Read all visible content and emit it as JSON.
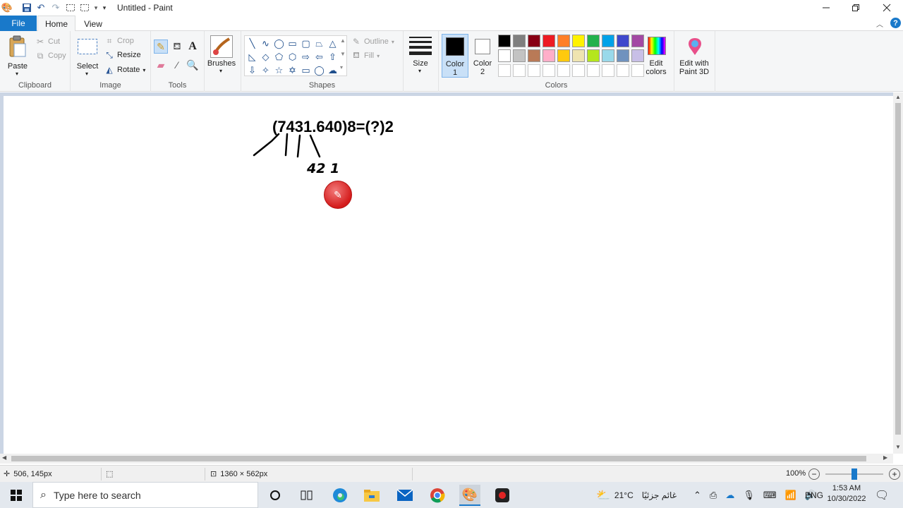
{
  "window": {
    "title": "Untitled - Paint",
    "minimize_icon": "minimize-icon",
    "restore_icon": "restore-icon",
    "close_icon": "close-icon"
  },
  "tabs": [
    "File",
    "Home",
    "View"
  ],
  "clipboard": {
    "paste": "Paste",
    "cut": "Cut",
    "copy": "Copy",
    "label": "Clipboard"
  },
  "image": {
    "select": "Select",
    "crop": "Crop",
    "resize": "Resize",
    "rotate": "Rotate",
    "label": "Image"
  },
  "tools": {
    "label": "Tools"
  },
  "brushes": {
    "label": "Brushes"
  },
  "shapes": {
    "outline": "Outline",
    "fill": "Fill",
    "label": "Shapes"
  },
  "size": {
    "label": "Size"
  },
  "colors": {
    "color1_label": "Color\n1",
    "color1_a": "Color",
    "color1_b": "1",
    "color2_a": "Color",
    "color2_b": "2",
    "color1_value": "#000000",
    "color2_value": "#ffffff",
    "palette_row1": [
      "#000000",
      "#7f7f7f",
      "#880015",
      "#ed1c24",
      "#ff7f27",
      "#fff200",
      "#22b14c",
      "#00a2e8",
      "#3f48cc",
      "#a349a4"
    ],
    "palette_row2": [
      "#ffffff",
      "#c3c3c3",
      "#b97a57",
      "#ffaec9",
      "#ffc90e",
      "#efe4b0",
      "#b5e61d",
      "#99d9ea",
      "#7092be",
      "#c8bfe7"
    ],
    "edit_a": "Edit",
    "edit_b": "colors",
    "label": "Colors"
  },
  "paint3d": {
    "line1": "Edit with",
    "line2": "Paint 3D"
  },
  "canvas": {
    "equation": "(7431.640)8=(?)2",
    "handwritten": "42 1"
  },
  "status": {
    "cursor_pos": "506, 145px",
    "canvas_size": "1360 × 562px",
    "zoom": "100%",
    "zoom_level": 0.5
  },
  "taskbar": {
    "search_placeholder": "Type here to search",
    "weather_temp": "21°C",
    "weather_text": "غائم جزئيًا",
    "language": "ENG",
    "time": "1:53 AM",
    "date": "10/30/2022"
  }
}
